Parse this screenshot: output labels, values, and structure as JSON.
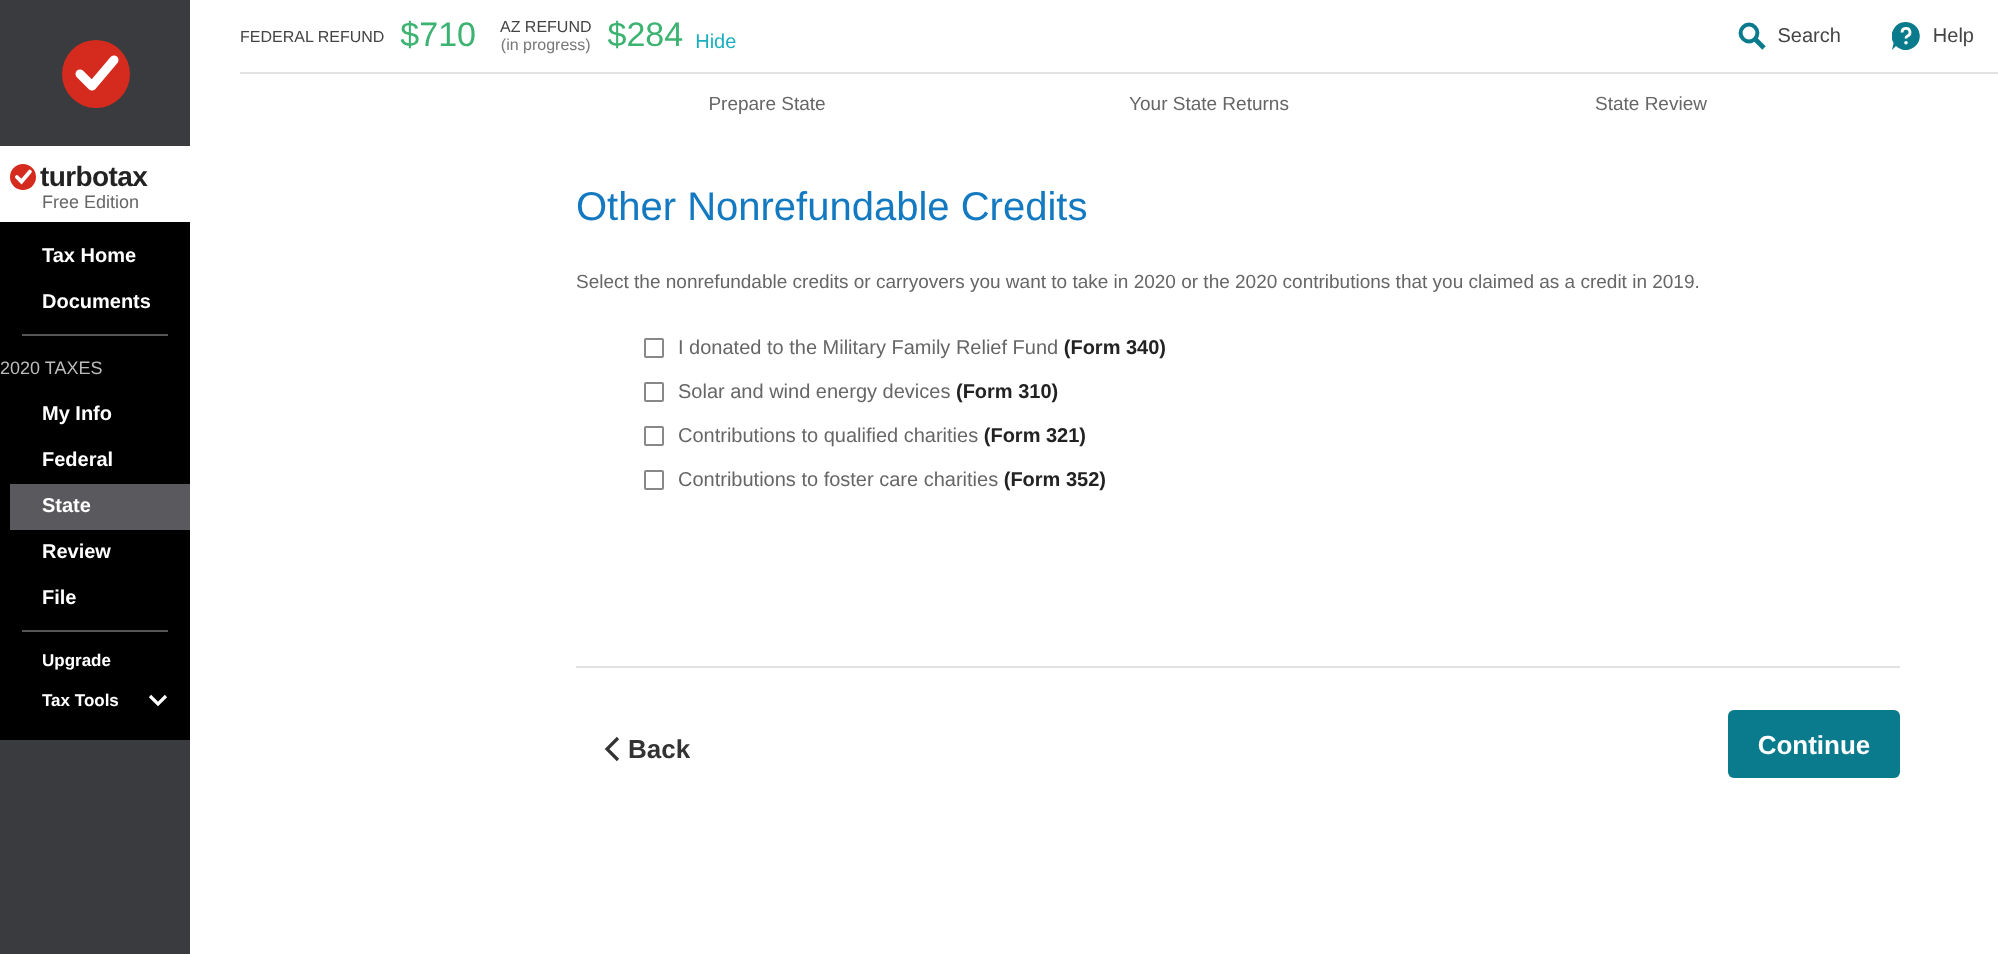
{
  "brand": {
    "name": "turbotax",
    "edition": "Free Edition"
  },
  "sidebar": {
    "groups": [
      {
        "items": [
          {
            "label": "Tax Home",
            "selected": false
          },
          {
            "label": "Documents",
            "selected": false
          }
        ]
      },
      {
        "heading": "2020 TAXES",
        "items": [
          {
            "label": "My Info",
            "selected": false
          },
          {
            "label": "Federal",
            "selected": false
          },
          {
            "label": "State",
            "selected": true
          },
          {
            "label": "Review",
            "selected": false
          },
          {
            "label": "File",
            "selected": false
          }
        ]
      },
      {
        "items": [
          {
            "label": "Upgrade",
            "selected": false
          },
          {
            "label": "Tax Tools",
            "selected": false,
            "expanded": false
          }
        ]
      }
    ]
  },
  "refunds": [
    {
      "label": "FEDERAL REFUND",
      "amount": "$710"
    },
    {
      "label": "AZ REFUND",
      "sublabel": "(in progress)",
      "amount": "$284"
    }
  ],
  "hide_link": "Hide",
  "header_actions": [
    {
      "kind": "search",
      "label": "Search"
    },
    {
      "kind": "help",
      "label": "Help"
    }
  ],
  "steps": [
    "Prepare State",
    "Your State Returns",
    "State Review"
  ],
  "title": "Other Nonrefundable Credits",
  "description": "Select the nonrefundable credits or carryovers you want to take in 2020 or the 2020 contributions that you claimed as a credit in 2019.",
  "options": [
    {
      "label": "I donated to the Military Family Relief Fund **(Form 340)**",
      "checked": false
    },
    {
      "label": "Solar and wind energy devices **(Form 310)**",
      "checked": false
    },
    {
      "label": "Contributions to qualified charities **(Form 321)**",
      "checked": false
    },
    {
      "label": "Contributions to foster care charities **(Form 352)**",
      "checked": false
    }
  ],
  "back": "Back",
  "continue": "Continue"
}
